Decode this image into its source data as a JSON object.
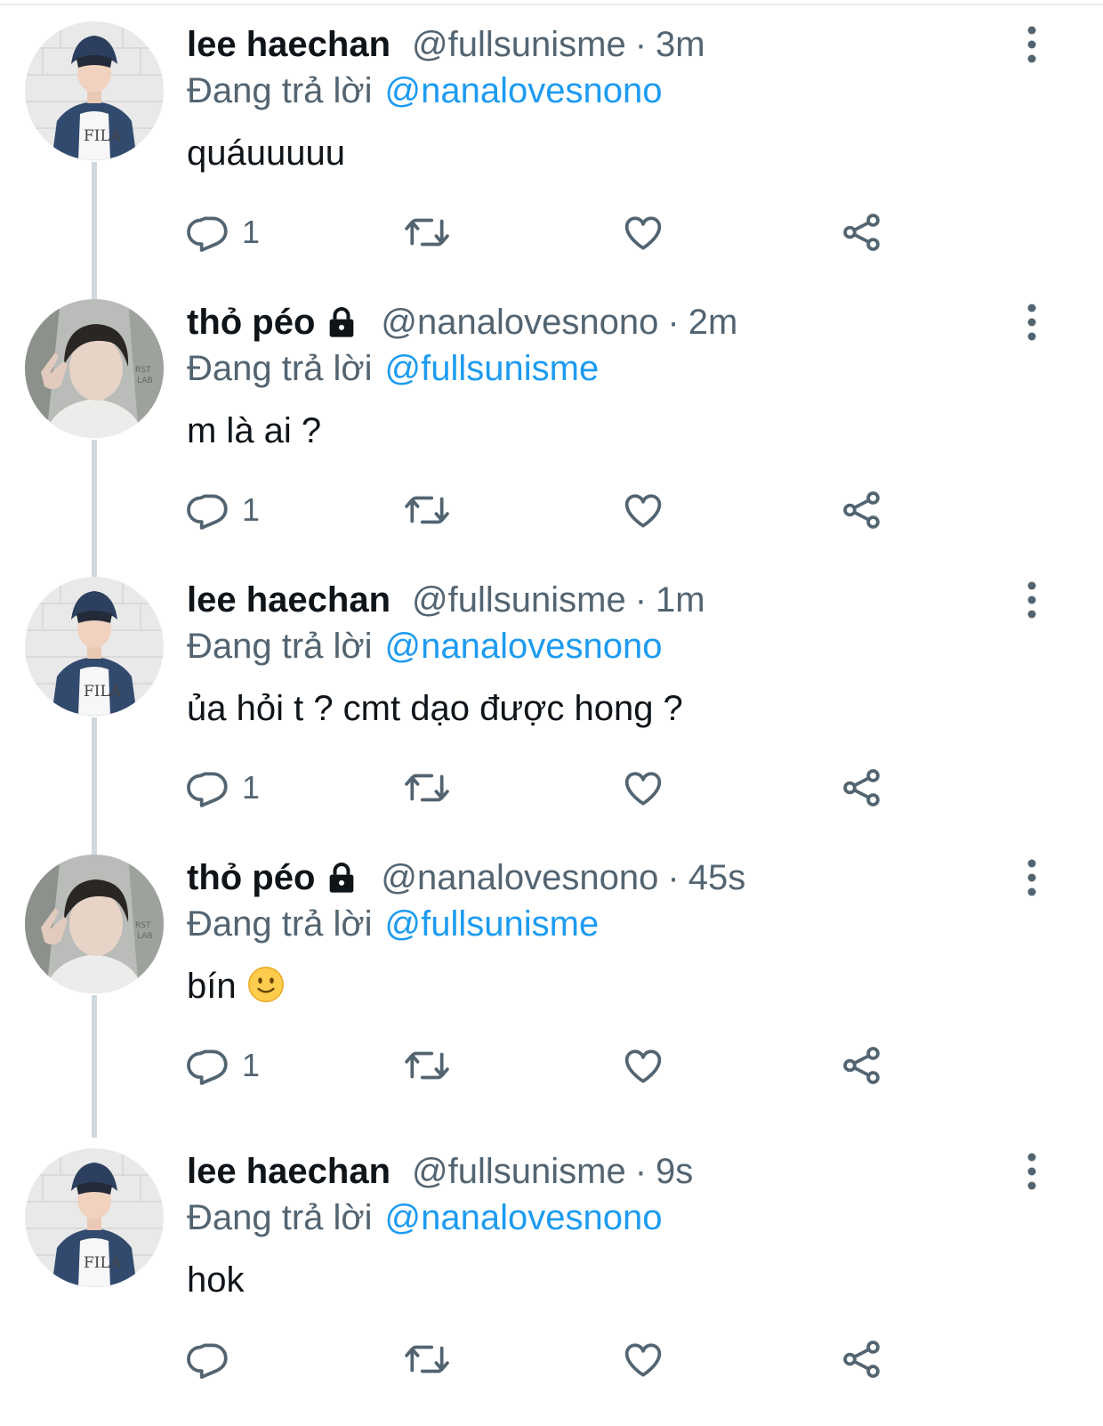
{
  "labels": {
    "replying_to": "Đang trả lời"
  },
  "colors": {
    "mention": "#1d9bf0",
    "muted": "#536471",
    "thread_line": "#cfd9de",
    "text": "#0f1419"
  },
  "tweets": [
    {
      "author": "lee haechan",
      "handle": "@fullsunisme",
      "time": "3m",
      "protected": false,
      "avatar": "haechan-avatar",
      "replying_to": "@nanalovesnono",
      "text": "quáuuuuu",
      "reply_count": "1"
    },
    {
      "author": "thỏ péo",
      "handle": "@nanalovesnono",
      "time": "2m",
      "protected": true,
      "avatar": "jaemin-avatar",
      "replying_to": "@fullsunisme",
      "text": "m là ai ?",
      "reply_count": "1"
    },
    {
      "author": "lee haechan",
      "handle": "@fullsunisme",
      "time": "1m",
      "protected": false,
      "avatar": "haechan-avatar",
      "replying_to": "@nanalovesnono",
      "text": "ủa hỏi t ? cmt dạo được hong ?",
      "reply_count": "1"
    },
    {
      "author": "thỏ péo",
      "handle": "@nanalovesnono",
      "time": "45s",
      "protected": true,
      "avatar": "jaemin-avatar",
      "replying_to": "@fullsunisme",
      "text": "bín",
      "emoji": "slightly-smiling-face",
      "reply_count": "1"
    },
    {
      "author": "lee haechan",
      "handle": "@fullsunisme",
      "time": "9s",
      "protected": false,
      "avatar": "haechan-avatar",
      "replying_to": "@nanalovesnono",
      "text": "hok",
      "reply_count": ""
    }
  ]
}
